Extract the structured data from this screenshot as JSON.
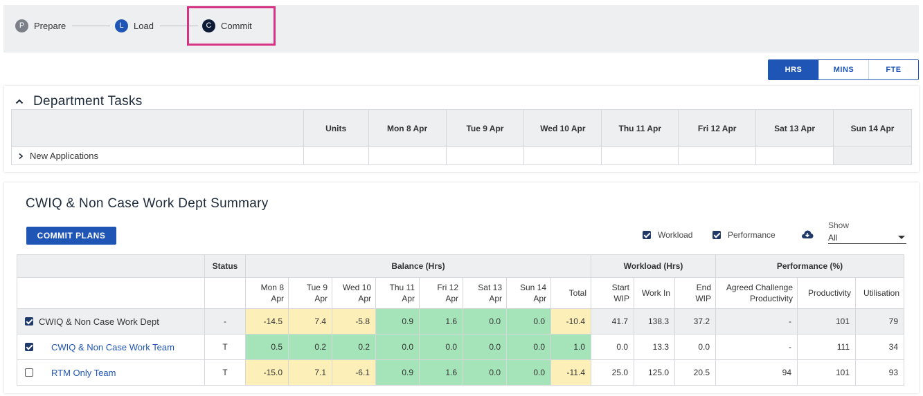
{
  "stepper": {
    "steps": [
      {
        "letter": "P",
        "label": "Prepare",
        "color": "#7b8088"
      },
      {
        "letter": "L",
        "label": "Load",
        "color": "#1f55b5"
      },
      {
        "letter": "C",
        "label": "Commit",
        "color": "#0d1b36"
      }
    ],
    "highlight_color": "#d63384"
  },
  "unit_toggle": {
    "options": [
      "HRS",
      "MINS",
      "FTE"
    ],
    "selected": "HRS"
  },
  "dept_tasks": {
    "title": "Department Tasks",
    "columns": [
      "",
      "Units",
      "Mon 8 Apr",
      "Tue 9 Apr",
      "Wed 10 Apr",
      "Thu 11 Apr",
      "Fri 12 Apr",
      "Sat 13 Apr",
      "Sun 14 Apr"
    ],
    "rows": [
      {
        "label": "New Applications"
      }
    ]
  },
  "summary": {
    "title": "CWIQ & Non Case Work Dept Summary",
    "commit_button": "COMMIT PLANS",
    "options": {
      "workload": "Workload",
      "performance": "Performance"
    },
    "show_label": "Show",
    "show_value": "All",
    "group_headers": {
      "status": "Status",
      "balance": "Balance (Hrs)",
      "workload": "Workload (Hrs)",
      "performance": "Performance (%)"
    },
    "sub_headers": {
      "balance": [
        "Mon 8\nApr",
        "Tue 9\nApr",
        "Wed 10\nApr",
        "Thu 11\nApr",
        "Fri 12\nApr",
        "Sat 13\nApr",
        "Sun 14\nApr",
        "Total"
      ],
      "workload": [
        "Start\nWIP",
        "Work In",
        "End\nWIP"
      ],
      "performance": [
        "Agreed Challenge\nProductivity",
        "Productivity",
        "Utilisation"
      ]
    },
    "rows": [
      {
        "name": "CWIQ & Non Case Work Dept",
        "checked": true,
        "status": "-",
        "balance": [
          "-14.5",
          "7.4",
          "-5.8",
          "0.9",
          "1.6",
          "0.0",
          "0.0",
          "-10.4"
        ],
        "workload": [
          "41.7",
          "138.3",
          "37.2"
        ],
        "performance": [
          "-",
          "101",
          "79"
        ]
      },
      {
        "name": "CWIQ & Non Case Work Team",
        "checked": true,
        "status": "T",
        "balance": [
          "0.5",
          "0.2",
          "0.2",
          "0.0",
          "0.0",
          "0.0",
          "0.0",
          "1.0"
        ],
        "workload": [
          "0.0",
          "13.3",
          "0.0"
        ],
        "performance": [
          "-",
          "111",
          "34"
        ]
      },
      {
        "name": "RTM Only Team",
        "checked": false,
        "status": "T",
        "balance": [
          "-15.0",
          "7.1",
          "-6.1",
          "0.9",
          "1.6",
          "0.0",
          "0.0",
          "-11.4"
        ],
        "workload": [
          "25.0",
          "125.0",
          "20.5"
        ],
        "performance": [
          "94",
          "101",
          "93"
        ]
      }
    ],
    "colors": {
      "negative_yellow": "#fcefb8",
      "positive_green": "#a5e4b9",
      "primary": "#1f55b5"
    }
  }
}
